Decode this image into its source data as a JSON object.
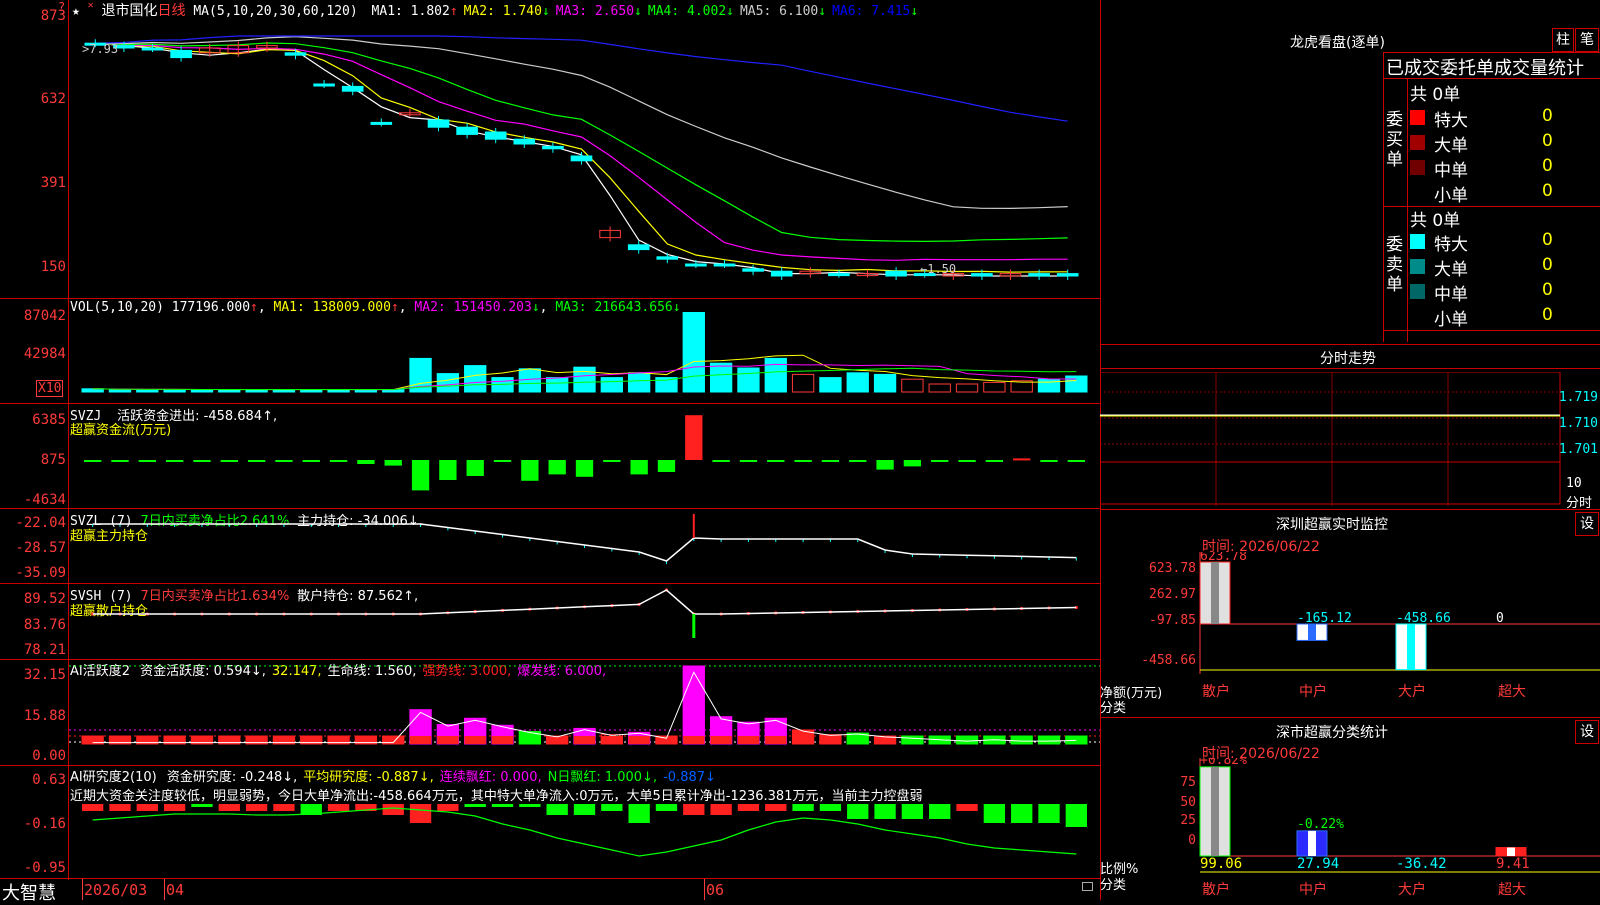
{
  "stock": {
    "name": "退市国化",
    "period": "日线",
    "star": "★"
  },
  "main_chart": {
    "ma_label": "MA(5,10,20,30,60,120)",
    "ma": [
      {
        "name": "MA1",
        "value": "1.802",
        "dir": "↑",
        "color": "#ffffff"
      },
      {
        "name": "MA2",
        "value": "1.740",
        "dir": "↓",
        "color": "#ffff00"
      },
      {
        "name": "MA3",
        "value": "2.650",
        "dir": "↓",
        "color": "#ff00ff"
      },
      {
        "name": "MA4",
        "value": "4.002",
        "dir": "↓",
        "color": "#00ff00"
      },
      {
        "name": "MA5",
        "value": "6.100",
        "dir": "↓",
        "color": "#cccccc"
      },
      {
        "name": "MA6",
        "value": "7.415",
        "dir": "↓",
        "color": "#0000ff"
      }
    ],
    "axis": [
      "873",
      "632",
      "391",
      "150"
    ],
    "high_mark": "7.93",
    "low_mark": "←1.50",
    "ranges_pct": {
      "open": [
        97,
        96,
        95,
        94,
        95,
        96,
        95,
        93,
        80,
        79,
        64,
        68,
        65,
        62,
        60,
        57,
        54,
        50,
        16,
        13,
        8,
        5,
        5,
        3,
        2,
        1,
        1,
        1,
        2,
        1,
        1,
        1,
        1,
        1,
        1
      ],
      "close": [
        97,
        95,
        95,
        91,
        93,
        93,
        96,
        92,
        80,
        77,
        64,
        68,
        62,
        59,
        57,
        55,
        53,
        48,
        19,
        11,
        7,
        5,
        5,
        2,
        0,
        2,
        1,
        1,
        0,
        1,
        0,
        0,
        0,
        0,
        0
      ],
      "up": [
        0,
        0,
        0,
        0,
        1,
        1,
        1,
        0,
        0,
        0,
        0,
        1,
        0,
        0,
        0,
        0,
        0,
        0,
        1,
        0,
        0,
        0,
        0,
        0,
        0,
        1,
        0,
        1,
        0,
        0,
        1,
        0,
        1,
        0,
        0
      ]
    }
  },
  "vol": {
    "label": "VOL(5,10,20)",
    "value": "177196.000",
    "ma1": "138009.000",
    "ma2": "151450.203",
    "ma3": "216643.656",
    "axis": [
      "87042",
      "42984"
    ],
    "unit": "X10",
    "bars": [
      4,
      3,
      3,
      3,
      3,
      3,
      3,
      3,
      3,
      3,
      3,
      3,
      42,
      23,
      33,
      18,
      29,
      18,
      31,
      18,
      24,
      18,
      100,
      36,
      30,
      42,
      22,
      18,
      24,
      22,
      16,
      10,
      10,
      12,
      14,
      16,
      20
    ],
    "up": [
      0,
      0,
      0,
      0,
      0,
      0,
      0,
      0,
      0,
      0,
      0,
      0,
      0,
      0,
      0,
      0,
      0,
      0,
      0,
      0,
      0,
      0,
      0,
      0,
      0,
      0,
      1,
      0,
      0,
      0,
      1,
      1,
      1,
      1,
      1,
      0,
      0
    ]
  },
  "svzj": {
    "label": "SVZJ",
    "title": "活跃资金进出: -458.684↑,",
    "subtitle": "超赢资金流(万元)",
    "axis": [
      "6385",
      "875",
      "-4634"
    ],
    "bars": [
      -2,
      -2,
      -2,
      -2,
      -2,
      -2,
      -2,
      -2,
      -2,
      -2,
      -5,
      -7,
      -38,
      -25,
      -20,
      -2,
      -26,
      -18,
      -21,
      -2,
      -18,
      -15,
      56,
      -2,
      -2,
      -2,
      -2,
      -2,
      -2,
      -12,
      -8,
      -2,
      -2,
      -2,
      2,
      -2,
      -2
    ]
  },
  "svzl": {
    "label": "SVZL (7)",
    "ratio": "7日内买卖净占比2.641%",
    "hold": "主力持仓: -34.006↓,",
    "subtitle": "超赢主力持仓",
    "axis": [
      "-22.04",
      "-28.57",
      "-35.09"
    ]
  },
  "svsh": {
    "label": "SVSH (7)",
    "ratio": "7日内买卖净占比1.634%",
    "hold": "散户持仓: 87.562↑,",
    "subtitle": "超赢散户持仓",
    "axis": [
      "89.52",
      "83.76",
      "78.21"
    ]
  },
  "ai_active": {
    "label": "AI活跃度2",
    "items": [
      {
        "t": "资金活跃度: 0.594↓,",
        "c": "#ffffff"
      },
      {
        "t": "32.147,",
        "c": "#ffff00"
      },
      {
        "t": "生命线: 1.560,",
        "c": "#ffffff"
      },
      {
        "t": "强势线: 3.000,",
        "c": "#ff2020"
      },
      {
        "t": "爆发线: 6.000,",
        "c": "#ff00ff"
      }
    ],
    "axis": [
      "32.15",
      "15.88",
      "0.00"
    ],
    "bars": [
      2,
      2,
      2,
      2,
      2,
      2,
      2,
      2,
      2,
      2,
      2,
      2,
      44,
      25,
      33,
      24,
      16,
      10,
      20,
      12,
      15,
      8,
      100,
      35,
      28,
      33,
      18,
      12,
      14,
      10,
      8,
      6,
      4,
      6,
      4,
      4,
      5
    ],
    "col": [
      "r",
      "r",
      "r",
      "r",
      "r",
      "r",
      "r",
      "r",
      "r",
      "r",
      "r",
      "r",
      "m",
      "m",
      "m",
      "m",
      "g",
      "h",
      "m",
      "h",
      "m",
      "h",
      "m",
      "m",
      "m",
      "m",
      "r",
      "r",
      "g",
      "h",
      "g",
      "g",
      "g",
      "g",
      "g",
      "g",
      "g"
    ]
  },
  "ai_research": {
    "label": "AI研究度2(10)",
    "items": [
      {
        "t": "资金研究度: -0.248↓,",
        "c": "#ffffff"
      },
      {
        "t": "平均研究度: -0.887↓,",
        "c": "#ffff00"
      },
      {
        "t": "连续飘红: 0.000,",
        "c": "#ff00ff"
      },
      {
        "t": "N日飘红: 1.000↓,",
        "c": "#00ff00"
      },
      {
        "t": "-0.887↓",
        "c": "#0060ff"
      }
    ],
    "comment": "近期大资金关注度较低，明显弱势，今日大单净流出:-458.664万元，其中特大单净流入:0万元，大单5日累计净出-1236.381万元，当前主力控盘弱",
    "axis": [
      "0.63",
      "-0.16",
      "-0.95"
    ]
  },
  "bottom_bar": {
    "brand": "大智慧",
    "date1": "2026/03",
    "date2": "04",
    "date3": "06"
  },
  "lhb": {
    "title": "龙虎看盘(逐单)",
    "btn1": "柱",
    "btn2": "笔",
    "tab": "已成交委托单成交量统计",
    "buy": {
      "side": "委买单",
      "total": "共 0单",
      "rows": [
        {
          "label": "特大",
          "value": "0",
          "color": "#ff0000"
        },
        {
          "label": "大单",
          "value": "0",
          "color": "#a00000"
        },
        {
          "label": "中单",
          "value": "0",
          "color": "#700000"
        },
        {
          "label": "小单",
          "value": "0",
          "color": ""
        }
      ]
    },
    "sell": {
      "side": "委卖单",
      "total": "共 0单",
      "rows": [
        {
          "label": "特大",
          "value": "0",
          "color": "#00ffff"
        },
        {
          "label": "大单",
          "value": "0",
          "color": "#008b8b"
        },
        {
          "label": "中单",
          "value": "0",
          "color": "#006666"
        },
        {
          "label": "小单",
          "value": "0",
          "color": ""
        }
      ]
    }
  },
  "fenshi": {
    "title": "分时走势",
    "axis": [
      "1.719",
      "1.710",
      "1.701"
    ],
    "vol_axis": "10",
    "vol_label": "分时"
  },
  "monitor": {
    "title": "深圳超赢实时监控",
    "set": "设",
    "date": "时间: 2026/06/22",
    "axis": [
      "623.78",
      "262.97",
      "-97.85",
      "-458.66"
    ],
    "ylabel": "净额(万元)",
    "xlabel": "分类",
    "categories": [
      "散户",
      "中户",
      "大户",
      "超大"
    ],
    "values": [
      623.78,
      -165.12,
      -458.66,
      0
    ],
    "labels": [
      "623.78",
      "-165.12",
      "-458.66",
      "0"
    ]
  },
  "classify": {
    "title": "深市超赢分类统计",
    "set": "设",
    "date": "时间: 2026/06/22",
    "axis": [
      "75",
      "50",
      "25",
      "0"
    ],
    "ylabel": "比例%",
    "xlabel": "分类",
    "categories": [
      "散户",
      "中户",
      "大户",
      "超大"
    ],
    "pct_top": [
      "+0.82%",
      "-0.22%",
      "",
      ""
    ],
    "values": [
      99.06,
      27.94,
      -36.42,
      9.41
    ],
    "labels": [
      "99.06",
      "27.94",
      "-36.42",
      "9.41"
    ]
  }
}
